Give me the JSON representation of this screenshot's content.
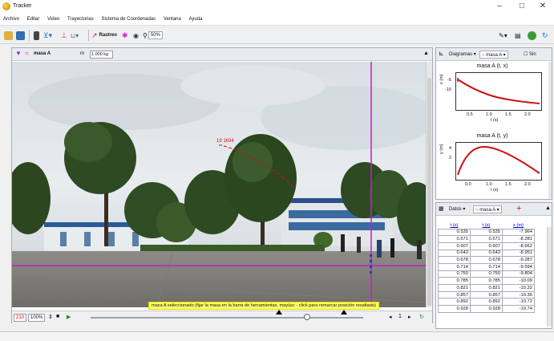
{
  "window": {
    "title": "Tracker",
    "minimize": "–",
    "maximize": "□",
    "close": "✕"
  },
  "menu": [
    "Archivo",
    "Editar",
    "Video",
    "Trayectorias",
    "Sistema de Coordenadas",
    "Ventana",
    "Ayuda"
  ],
  "toolbar": {
    "rastreo_label": "Rastreo",
    "zoom_label": "50%"
  },
  "video_panel": {
    "track_label": "masa A",
    "mass_label": "m",
    "mass_value": "1.000 kg",
    "status_message": "masa A seleccionado (fijar la masa en la barra de herramientas, mayúsc - click para remarcar posición resaltada)",
    "frame_number": "210",
    "rate_value": "100%"
  },
  "graphs_panel": {
    "diagramas_label": "Diagramas",
    "track_label": "masa A",
    "sin_label": "Sin",
    "graph1": {
      "title": "masa A (t, x)",
      "ylabel": "x (m)",
      "xlabel": "t (s)",
      "xticks": [
        "0.5",
        "1.0",
        "1.5",
        "2.0"
      ],
      "yticks": [
        "-5",
        "-10"
      ]
    },
    "graph2": {
      "title": "masa A (t, y)",
      "ylabel": "y (m)",
      "xlabel": "t (s)",
      "xticks": [
        "0.0",
        "1.0",
        "1.5",
        "2.0"
      ],
      "yticks": [
        "4",
        "2"
      ]
    }
  },
  "table_panel": {
    "datos_label": "Datos",
    "track_label": "masa A",
    "columns": [
      "t (s)",
      "t (s)",
      "x (m)"
    ],
    "rows": [
      [
        "0.535",
        "0.535",
        "-7.964"
      ],
      [
        "0.571",
        "0.571",
        "-8.281"
      ],
      [
        "0.607",
        "0.607",
        "-8.662"
      ],
      [
        "0.643",
        "0.643",
        "-8.951"
      ],
      [
        "0.678",
        "0.678",
        "-9.287"
      ],
      [
        "0.714",
        "0.714",
        "-9.594"
      ],
      [
        "0.750",
        "0.750",
        "-9.804"
      ],
      [
        "0.785",
        "0.785",
        "-10.09"
      ],
      [
        "0.821",
        "0.821",
        "-10.32"
      ],
      [
        "0.857",
        "0.857",
        "-10.36"
      ],
      [
        "0.892",
        "0.892",
        "-10.72"
      ],
      [
        "0.928",
        "0.928",
        "-10.74"
      ]
    ]
  },
  "colors": {
    "track": "#cc1111",
    "axis": "#c020c0",
    "highlight": "#ffff66"
  }
}
